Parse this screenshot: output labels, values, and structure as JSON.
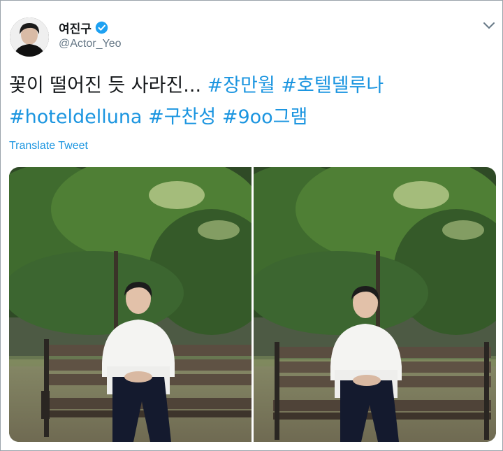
{
  "tweet": {
    "author": {
      "display_name": "여진구",
      "handle": "@Actor_Yeo",
      "verified": true,
      "avatar_icon": "profile-photo"
    },
    "text_plain": "꽃이 떨어진 듯 사라진...",
    "hashtags_line1": [
      "#장만월",
      "#호텔델루나"
    ],
    "hashtags_line2": [
      "#hoteldelluna",
      "#구찬성",
      "#9oo그램"
    ],
    "translate_label": "Translate Tweet",
    "menu_icon": "chevron-down-icon",
    "media": [
      {
        "description": "photo-1"
      },
      {
        "description": "photo-2"
      }
    ]
  },
  "colors": {
    "link": "#1b95e0",
    "text": "#14171a",
    "secondary": "#657786",
    "verified": "#1da1f2"
  }
}
